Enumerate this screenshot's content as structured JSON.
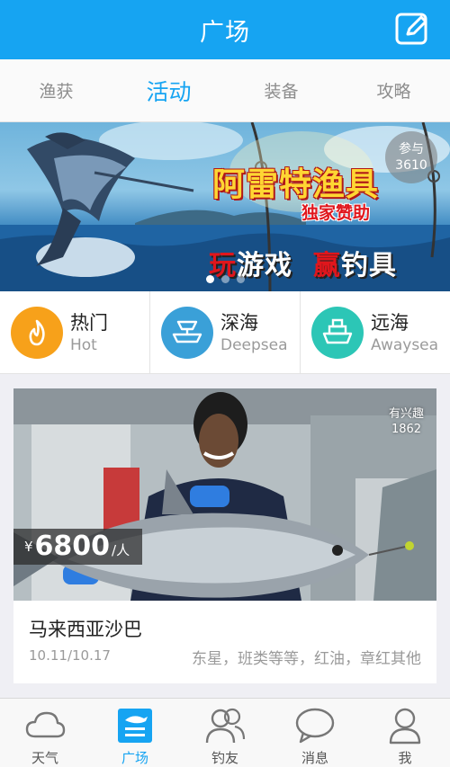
{
  "header": {
    "title": "广场",
    "compose_icon": "compose-icon"
  },
  "tabs": [
    {
      "label": "渔获",
      "active": false
    },
    {
      "label": "活动",
      "active": true
    },
    {
      "label": "装备",
      "active": false
    },
    {
      "label": "攻略",
      "active": false
    }
  ],
  "banner": {
    "title": "阿雷特渔具",
    "subtitle": "独家赞助",
    "slogan_1_em": "玩",
    "slogan_1": "游戏",
    "slogan_2_em": "赢",
    "slogan_2": "钓具",
    "participants_label": "参与",
    "participants_count": "3610",
    "page_index": 1,
    "page_total": 3
  },
  "categories": [
    {
      "cn": "热门",
      "en": "Hot",
      "icon": "flame-icon",
      "color": "#f7a11a"
    },
    {
      "cn": "深海",
      "en": "Deepsea",
      "icon": "boat-icon",
      "color": "#3aa0d8"
    },
    {
      "cn": "远海",
      "en": "Awaysea",
      "icon": "ship-icon",
      "color": "#2cc6b6"
    }
  ],
  "activity": {
    "interest_label": "有兴趣",
    "interest_count": "1862",
    "price_currency": "¥",
    "price": "6800",
    "price_unit": "/人",
    "title": "马来西亚沙巴",
    "date": "10.11/10.17",
    "tags": "东星，班类等等，红油，章红其他"
  },
  "tabbar": [
    {
      "label": "天气",
      "icon": "cloud-icon",
      "active": false
    },
    {
      "label": "广场",
      "icon": "plaza-icon",
      "active": true
    },
    {
      "label": "钓友",
      "icon": "friends-icon",
      "active": false
    },
    {
      "label": "消息",
      "icon": "message-icon",
      "active": false
    },
    {
      "label": "我",
      "icon": "person-icon",
      "active": false
    }
  ],
  "colors": {
    "primary": "#16a4f2",
    "background": "#efeff4"
  }
}
